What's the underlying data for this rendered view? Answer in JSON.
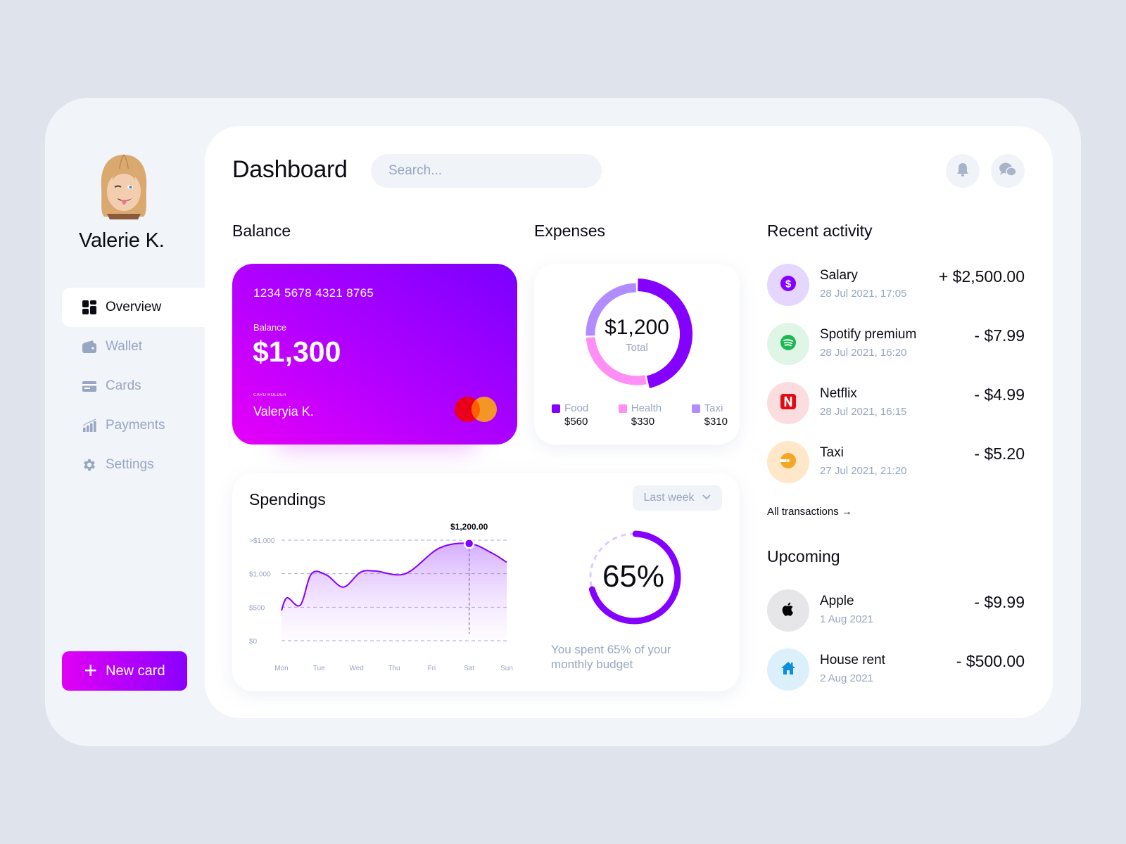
{
  "user": {
    "name": "Valerie K."
  },
  "sidebar": {
    "items": [
      {
        "label": "Overview",
        "icon": "grid-icon",
        "active": true
      },
      {
        "label": "Wallet",
        "icon": "wallet-icon",
        "active": false
      },
      {
        "label": "Cards",
        "icon": "card-icon",
        "active": false
      },
      {
        "label": "Payments",
        "icon": "bar-chart-icon",
        "active": false
      },
      {
        "label": "Settings",
        "icon": "gear-icon",
        "active": false
      }
    ],
    "new_card_label": "New card"
  },
  "header": {
    "title": "Dashboard",
    "search_placeholder": "Search...",
    "icons": [
      "bell-icon",
      "chat-icon"
    ]
  },
  "balance": {
    "section_title": "Balance",
    "card_number": "1234 5678 4321 8765",
    "balance_label": "Balance",
    "balance_value": "$1,300",
    "holder_label": "CARD HOLDER",
    "holder_name": "Valeryia K."
  },
  "expenses": {
    "section_title": "Expenses",
    "total": "$1,200",
    "total_label": "Total",
    "categories": [
      {
        "name": "Food",
        "value": "$560",
        "amount": 560,
        "color": "#8400ff"
      },
      {
        "name": "Health",
        "value": "$330",
        "amount": 330,
        "color": "#ff8ef5"
      },
      {
        "name": "Taxi",
        "value": "$310",
        "amount": 310,
        "color": "#b18cff"
      }
    ]
  },
  "spendings": {
    "title": "Spendings",
    "period": "Last week",
    "budget_percent": 65,
    "budget_percent_label": "65%",
    "budget_text": "You spent 65% of your monthly budget"
  },
  "chart_data": {
    "type": "area",
    "title": "Spendings",
    "x": [
      "Mon",
      "Tue",
      "Wed",
      "Thu",
      "Fri",
      "Sat",
      "Sun"
    ],
    "y_tick_labels": [
      "$0",
      "$500",
      "$1,000",
      ">$1,000"
    ],
    "y_tick_values": [
      0,
      500,
      1000,
      1500
    ],
    "series": [
      {
        "name": "Spendings",
        "points": [
          [
            0,
            450
          ],
          [
            0.15,
            640
          ],
          [
            0.5,
            530
          ],
          [
            0.8,
            1000
          ],
          [
            1.2,
            980
          ],
          [
            1.65,
            800
          ],
          [
            2.1,
            1020
          ],
          [
            2.5,
            1040
          ],
          [
            3.3,
            1000
          ],
          [
            4.2,
            1380
          ],
          [
            5.0,
            1450
          ],
          [
            5.6,
            1310
          ],
          [
            6.0,
            1170
          ]
        ]
      }
    ],
    "highlight": {
      "x": "Sat",
      "label": "$1,200.00"
    },
    "ylim": [
      0,
      1500
    ],
    "grid": true
  },
  "activity": {
    "section_title": "Recent activity",
    "items": [
      {
        "name": "Salary",
        "date": "28 Jul 2021, 17:05",
        "amount": "+ $2,500.00",
        "icon": "dollar-icon",
        "bg": "#e4d6ff",
        "fg": "#8400ff"
      },
      {
        "name": "Spotify premium",
        "date": "28 Jul 2021, 16:20",
        "amount": "- $7.99",
        "icon": "spotify-icon",
        "bg": "#dff5e6",
        "fg": "#1db954"
      },
      {
        "name": "Netflix",
        "date": "28 Jul 2021, 16:15",
        "amount": "- $4.99",
        "icon": "netflix-icon",
        "bg": "#fbdde0",
        "fg": "#e50914"
      },
      {
        "name": "Taxi",
        "date": "27 Jul 2021, 21:20",
        "amount": "- $5.20",
        "icon": "taxi-icon",
        "bg": "#ffe8c9",
        "fg": "#f5a623"
      }
    ],
    "all_link": "All transactions →"
  },
  "upcoming": {
    "section_title": "Upcoming",
    "items": [
      {
        "name": "Apple",
        "date": "1 Aug 2021",
        "amount": "- $9.99",
        "icon": "apple-icon",
        "bg": "#e6e6e8",
        "fg": "#000000"
      },
      {
        "name": "House rent",
        "date": "2 Aug 2021",
        "amount": "- $500.00",
        "icon": "house-icon",
        "bg": "#dcf0fb",
        "fg": "#0a8fdc"
      }
    ]
  }
}
